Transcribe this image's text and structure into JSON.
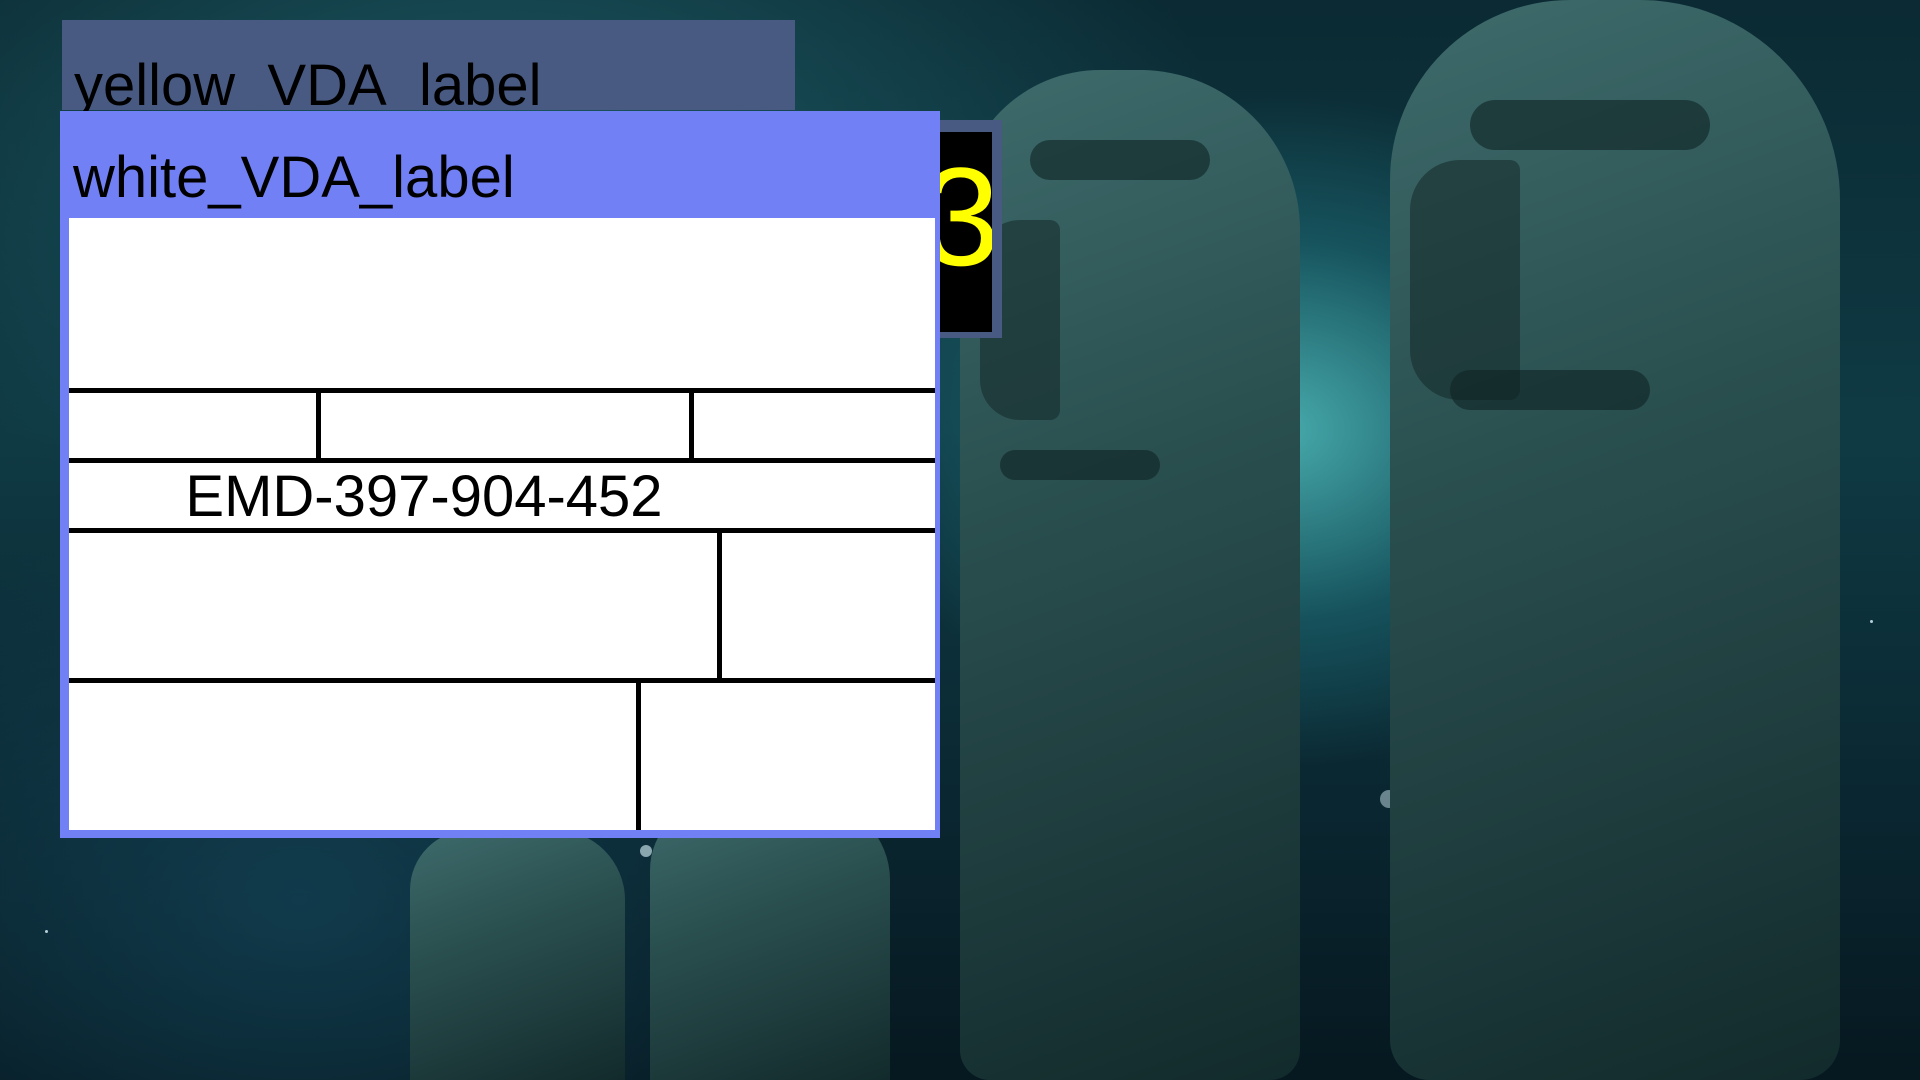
{
  "windows": {
    "back": {
      "title": "yellow_VDA_label"
    },
    "front": {
      "title": "white_VDA_label",
      "form": {
        "document_id": "EMD-397-904-452"
      }
    },
    "black_panel": {
      "digit": "3"
    }
  },
  "colors": {
    "back_window_bg": "#485a82",
    "front_window_bg": "#7280f5",
    "form_bg": "#ffffff",
    "panel_digit": "#ffff00",
    "yellow_strip": "#ffff00"
  },
  "background": {
    "description_icon": "moai-statues-wallpaper"
  }
}
